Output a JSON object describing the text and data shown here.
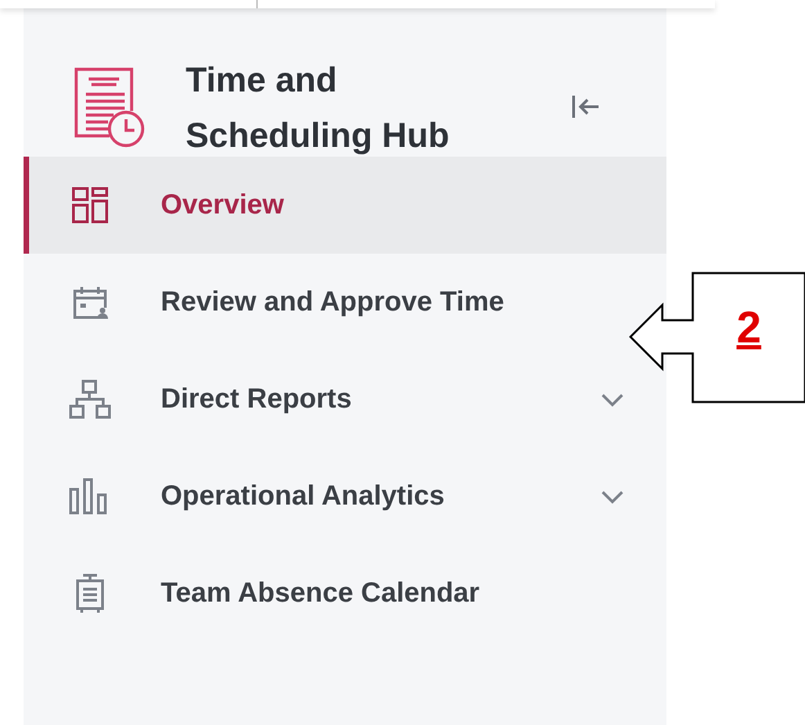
{
  "sidebar": {
    "title_lines": [
      "Time and",
      "Scheduling Hub"
    ],
    "items": [
      {
        "label": "Overview",
        "selected": true
      },
      {
        "label": "Review and Approve Time",
        "selected": false
      },
      {
        "label": "Direct Reports",
        "selected": false,
        "expanded": false
      },
      {
        "label": "Operational Analytics",
        "selected": false,
        "expanded": false
      },
      {
        "label": "Team Absence Calendar",
        "selected": false
      }
    ]
  },
  "callout": {
    "number": "2"
  }
}
